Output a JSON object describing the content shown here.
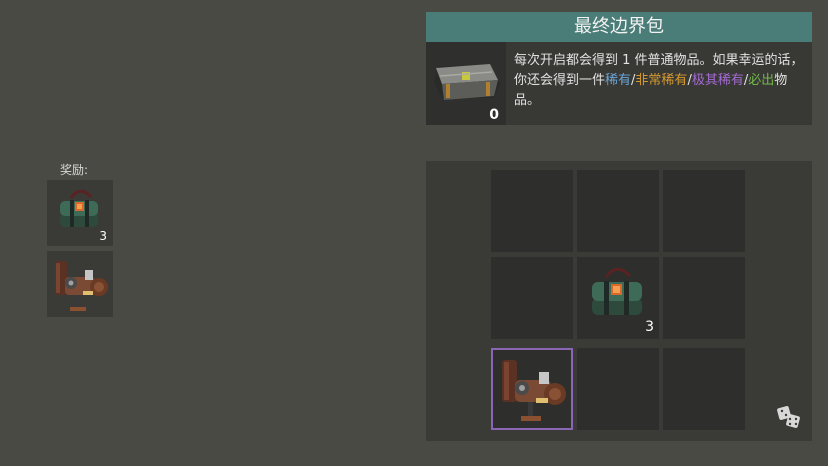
{
  "rewards": {
    "label": "奖励:",
    "items": [
      {
        "icon": "supply-bag-icon",
        "count": "3"
      },
      {
        "icon": "generator-machine-icon",
        "count": ""
      }
    ]
  },
  "info": {
    "title": "最终边界包",
    "item_count": "0",
    "description": {
      "part1": "每次开启都会得到 1 件普通物品。如果幸运的话，你还会得到一件",
      "rare": "稀有",
      "sep1": "/",
      "very_rare": "非常稀有",
      "sep2": "/",
      "extremely_rare": "极其稀有",
      "sep3": "/",
      "must_have": "必出",
      "part2": "物品。"
    },
    "colors": {
      "rare": "#6aa5d6",
      "very_rare": "#d69a2f",
      "extremely_rare": "#a46bd3",
      "must_have": "#72b94a"
    }
  },
  "grid": {
    "cells": [
      {
        "item": null,
        "count": ""
      },
      {
        "item": null,
        "count": ""
      },
      {
        "item": null,
        "count": ""
      },
      {
        "item": null,
        "count": ""
      },
      {
        "item": "supply-bag-icon",
        "count": "3"
      },
      {
        "item": null,
        "count": ""
      },
      {
        "item": "generator-machine-icon",
        "count": "",
        "selected": true
      },
      {
        "item": null,
        "count": ""
      },
      {
        "item": null,
        "count": ""
      }
    ],
    "randomize_icon": "dice-icon"
  }
}
